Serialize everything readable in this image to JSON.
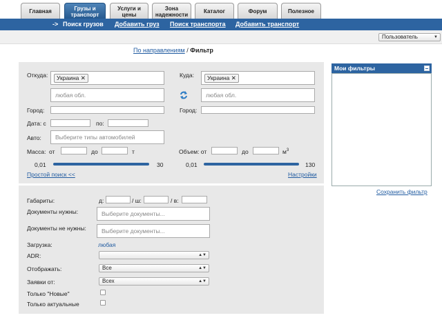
{
  "tabs": [
    {
      "label": "Главная",
      "active": false
    },
    {
      "label": "Грузы и транспорт",
      "active": true
    },
    {
      "label": "Услуги и цены",
      "active": false
    },
    {
      "label": "Зона надежности",
      "active": false
    },
    {
      "label": "Каталог",
      "active": false
    },
    {
      "label": "Форум",
      "active": false
    },
    {
      "label": "Полезное",
      "active": false
    }
  ],
  "subnav": {
    "current_prefix": "->",
    "current": "Поиск грузов",
    "add_cargo": "Добавить груз",
    "search_transport": "Поиск транспорта",
    "add_transport": "Добавить транспорт"
  },
  "user_select": {
    "value": "Пользователь"
  },
  "breadcrumb": {
    "link": "По направлениям",
    "separator": "/",
    "current": "Фильтр"
  },
  "filter": {
    "from_label": "Откуда:",
    "from_country": "Украина",
    "from_region_placeholder": "любая обл.",
    "to_label": "Куда:",
    "to_country": "Украина",
    "to_region_placeholder": "любая обл.",
    "city_label": "Город:",
    "city_label_to": "Город:",
    "date_from_label": "Дата: с",
    "date_to_label": "по:",
    "auto_label": "Авто:",
    "auto_placeholder": "Выберите типы автомобилей",
    "mass_label": "Масса:",
    "mass_from": "от",
    "mass_to": "до",
    "mass_unit": "т",
    "mass_min": "0,01",
    "mass_max": "30",
    "volume_label": "Объем: от",
    "volume_to": "до",
    "volume_unit": "м",
    "volume_sup": "3",
    "volume_min": "0,01",
    "volume_max": "130",
    "simple_search": "Простой поиск <<",
    "settings": "Настройки"
  },
  "extra": {
    "dims_label": "Габариты:",
    "dims_l": "д:",
    "dims_w": "/ ш:",
    "dims_h": "/ в:",
    "docs_need_label": "Документы нужны:",
    "docs_need_placeholder": "Выберите документы...",
    "docs_not_need_label": "Документы не нужны:",
    "docs_not_need_placeholder": "Выберите документы...",
    "loading_label": "Загрузка:",
    "loading_value": "любая",
    "adr_label": "ADR:",
    "adr_value": "",
    "display_label": "Отображать:",
    "display_value": "Все",
    "requests_label": "Заявки от:",
    "requests_value": "Всех",
    "only_new_label": "Только \"Новые\"",
    "only_actual_label": "Только актуальные"
  },
  "sidebar": {
    "title": "Мои фильтры",
    "save": "Сохранить фильтр"
  },
  "icons": {
    "swap": "swap-arrows-icon",
    "remove": "close-icon",
    "dropdown": "chevron-down-icon",
    "minimize": "minimize-icon"
  },
  "colors": {
    "accent": "#2d64a1",
    "link": "#1f5aa0",
    "panel": "#e8e8e8"
  }
}
